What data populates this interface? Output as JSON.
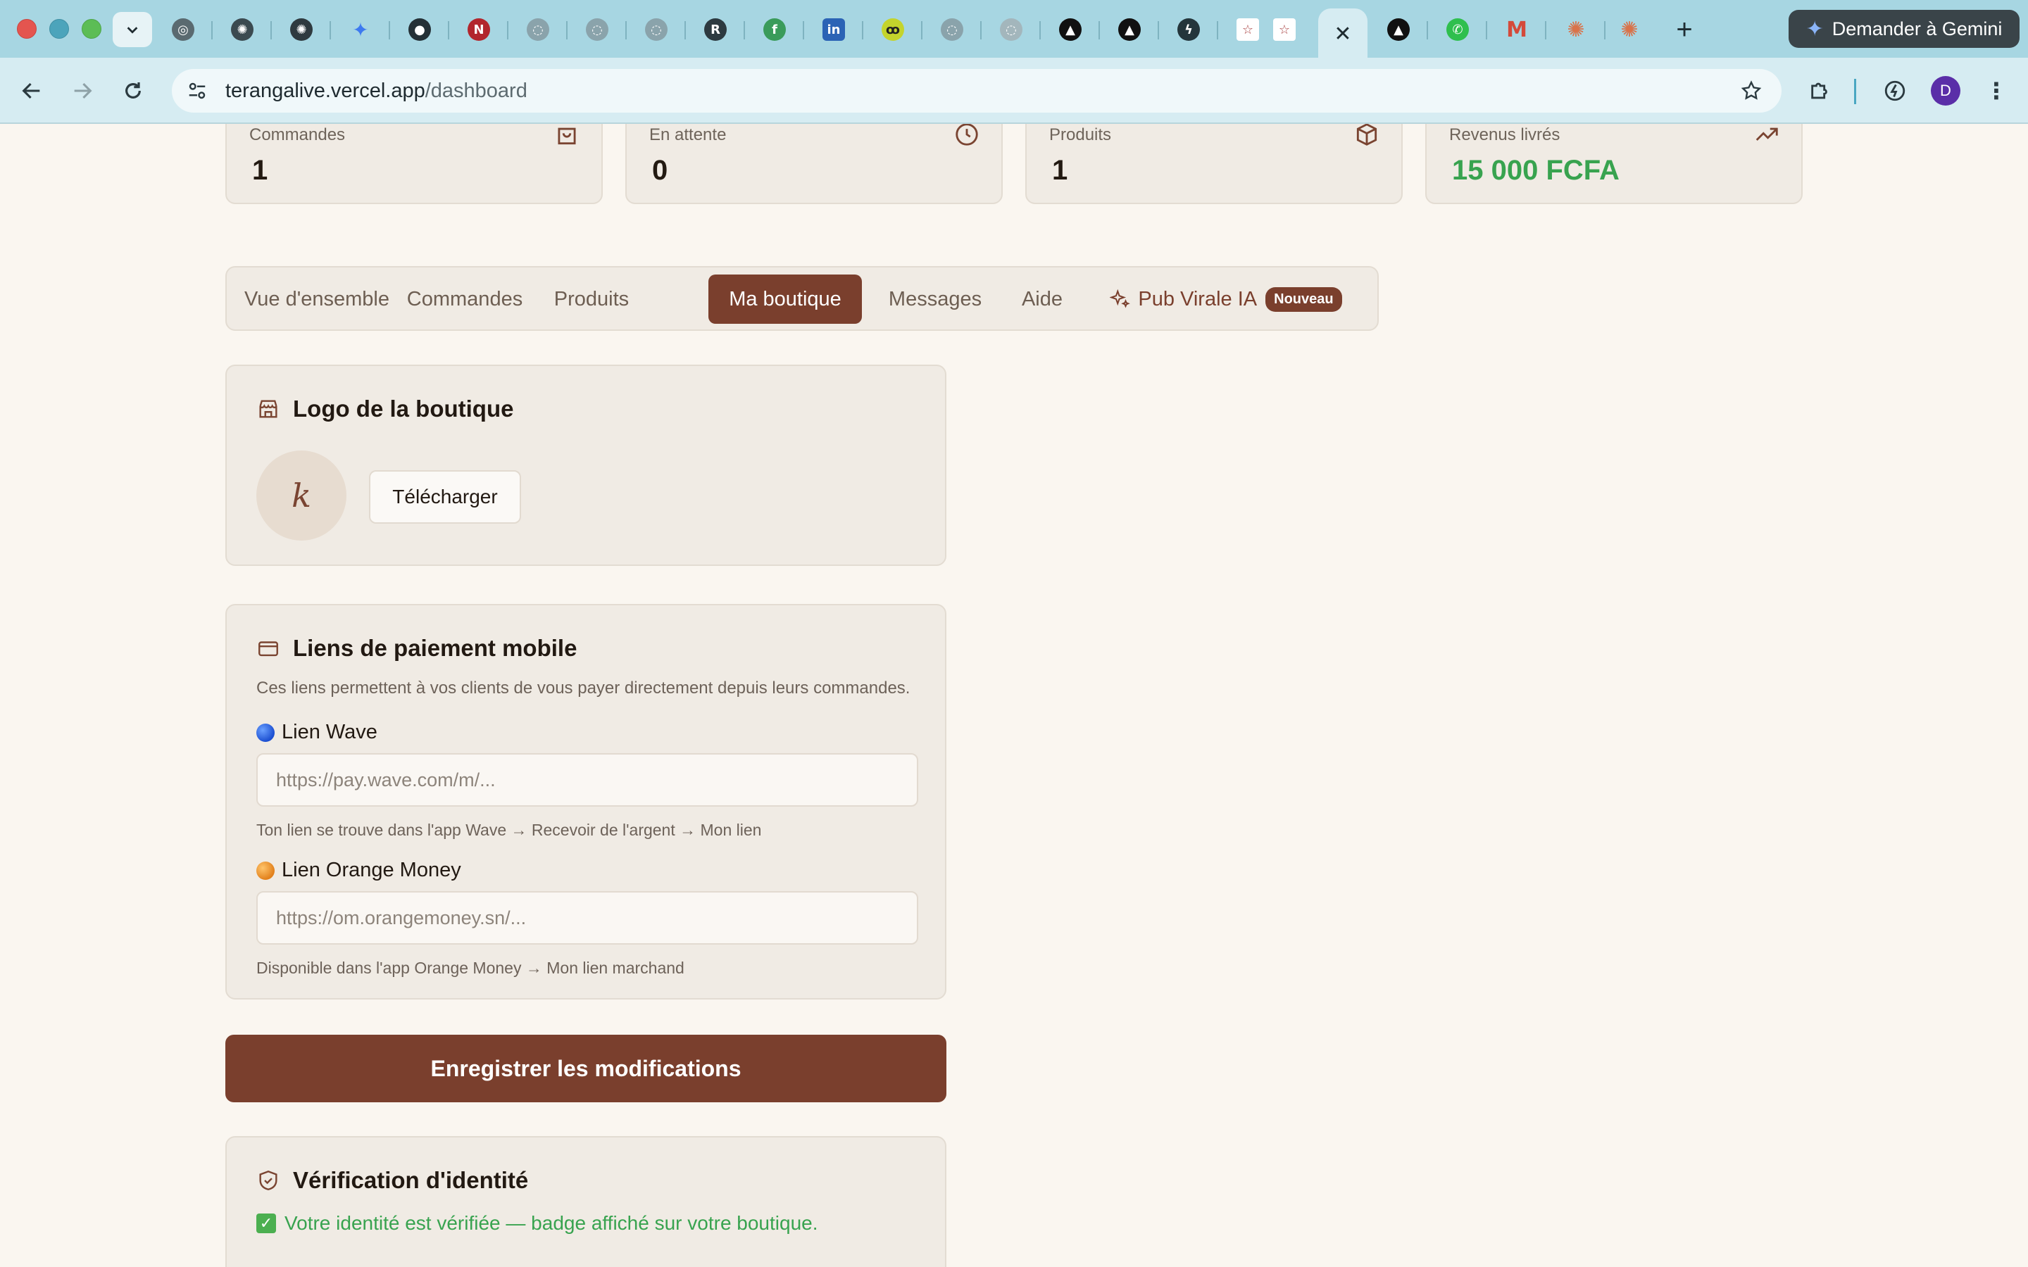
{
  "browser": {
    "url_host": "terangalive.vercel.app",
    "url_path": "/dashboard",
    "gemini_label": "Demander à Gemini",
    "profile_initial": "D"
  },
  "stats": [
    {
      "label": "Commandes",
      "value": "1",
      "icon": "shopping-bag-icon"
    },
    {
      "label": "En attente",
      "value": "0",
      "icon": "clock-icon"
    },
    {
      "label": "Produits",
      "value": "1",
      "icon": "box-icon"
    },
    {
      "label": "Revenus livrés",
      "value": "15 000 FCFA",
      "icon": "trending-up-icon"
    }
  ],
  "tabs": [
    {
      "label": "Vue d'ensemble"
    },
    {
      "label": "Commandes"
    },
    {
      "label": "Produits"
    },
    {
      "label": "Ma boutique"
    },
    {
      "label": "Messages"
    },
    {
      "label": "Aide"
    },
    {
      "label": "Pub Virale IA",
      "badge": "Nouveau"
    }
  ],
  "active_tab": "Ma boutique",
  "logo_card": {
    "title": "Logo de la boutique",
    "initial": "k",
    "upload_label": "Télécharger"
  },
  "payment_card": {
    "title": "Liens de paiement mobile",
    "description": "Ces liens permettent à vos clients de vous payer directement depuis leurs commandes.",
    "wave": {
      "label": "Lien Wave",
      "placeholder": "https://pay.wave.com/m/...",
      "hint": "Ton lien se trouve dans l'app Wave → Recevoir de l'argent → Mon lien"
    },
    "orange": {
      "label": "Lien Orange Money",
      "placeholder": "https://om.orangemoney.sn/...",
      "hint": "Disponible dans l'app Orange Money → Mon lien marchand"
    }
  },
  "save_label": "Enregistrer les modifications",
  "verification_card": {
    "title": "Vérification d'identité",
    "status": "Votre identité est vérifiée — badge affiché sur votre boutique."
  },
  "colors": {
    "accent": "#7a3f2d",
    "success": "#38a34f",
    "card_bg": "#f0ebe4",
    "page_bg": "#faf6f0"
  }
}
